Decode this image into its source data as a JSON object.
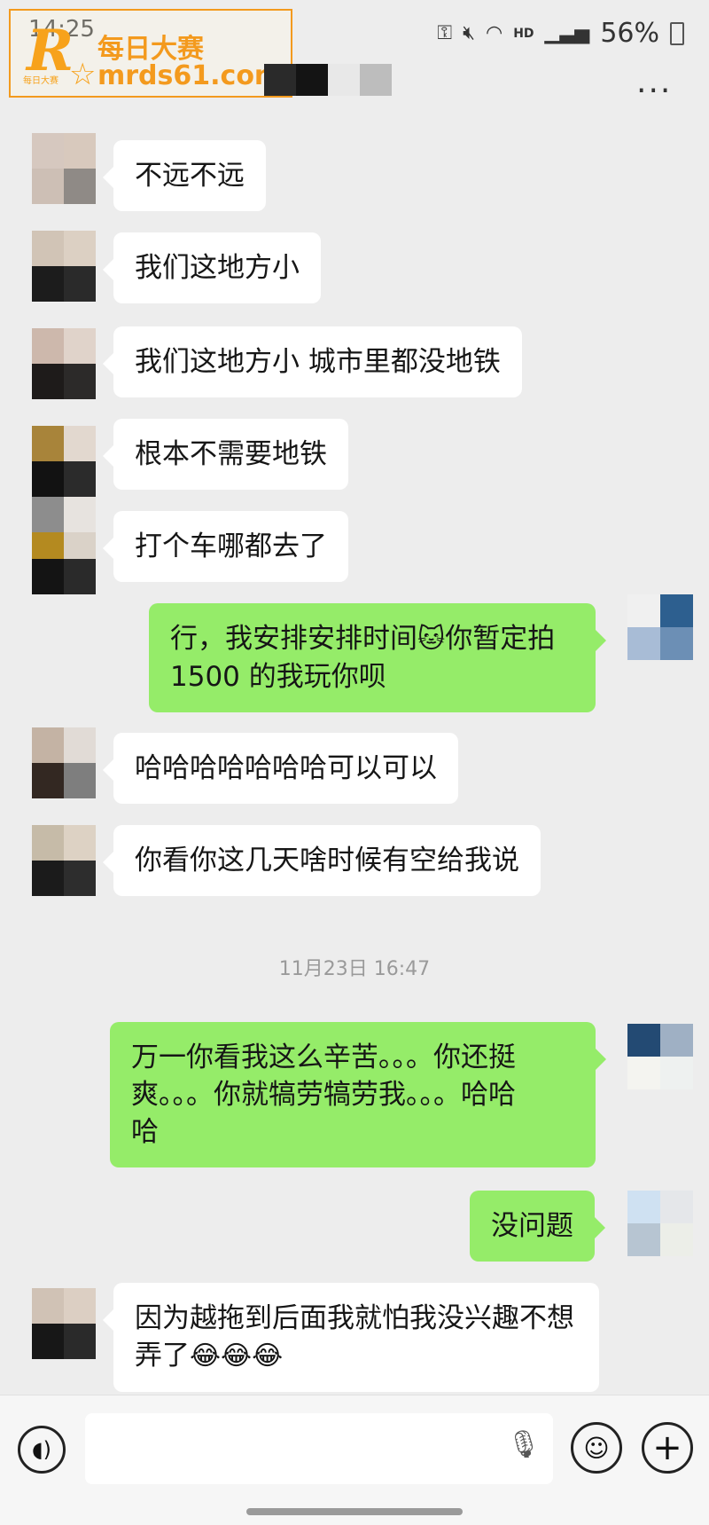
{
  "status_bar": {
    "time": "14:25",
    "icons": [
      "key-icon",
      "mute-icon",
      "wifi-icon",
      "hd-icon",
      "signal-icon"
    ],
    "hd_label": "HD",
    "battery": "56%"
  },
  "watermark": {
    "logo_letter": "R",
    "brand_small": "每日大赛",
    "title": "每日大赛",
    "url": "mrds61.com"
  },
  "header": {
    "more_label": "···"
  },
  "messages": [
    {
      "sender": "other",
      "text": "不远不远"
    },
    {
      "sender": "other",
      "text": "我们这地方小"
    },
    {
      "sender": "other",
      "text": "我们这地方小 城市里都没地铁"
    },
    {
      "sender": "other",
      "text": "根本不需要地铁"
    },
    {
      "sender": "other",
      "text": "打个车哪都去了"
    },
    {
      "sender": "me",
      "text_line1_a": "行，我安排安排时间",
      "emoji": "🐱",
      "text_line1_b": "你暂定拍",
      "text_line2": "1500 的我玩你呗"
    },
    {
      "sender": "other",
      "text": "哈哈哈哈哈哈哈可以可以"
    },
    {
      "sender": "other",
      "text": "你看你这几天啥时候有空给我说"
    },
    {
      "sender": "me",
      "text_line1": "万一你看我这么辛苦。。。你还挺",
      "text_line2": "爽。。。你就犒劳犒劳我。。。哈哈",
      "text_line3": "哈"
    },
    {
      "sender": "me",
      "text": "没问题"
    },
    {
      "sender": "other",
      "text_line1": "因为越拖到后面我就怕我没兴趣不想",
      "text_line2": "弄了",
      "emoji": "😂😂😂"
    }
  ],
  "timestamp": "11月23日 16:47",
  "input_bar": {
    "voice_icon": "voice-icon",
    "mic_icon": "microphone-icon",
    "emoji_icon": "smiley-icon",
    "plus_icon": "plus-icon"
  },
  "colors": {
    "background": "#ededed",
    "bubble_other": "#ffffff",
    "bubble_me": "#95ec69",
    "watermark": "#f39a1e"
  }
}
